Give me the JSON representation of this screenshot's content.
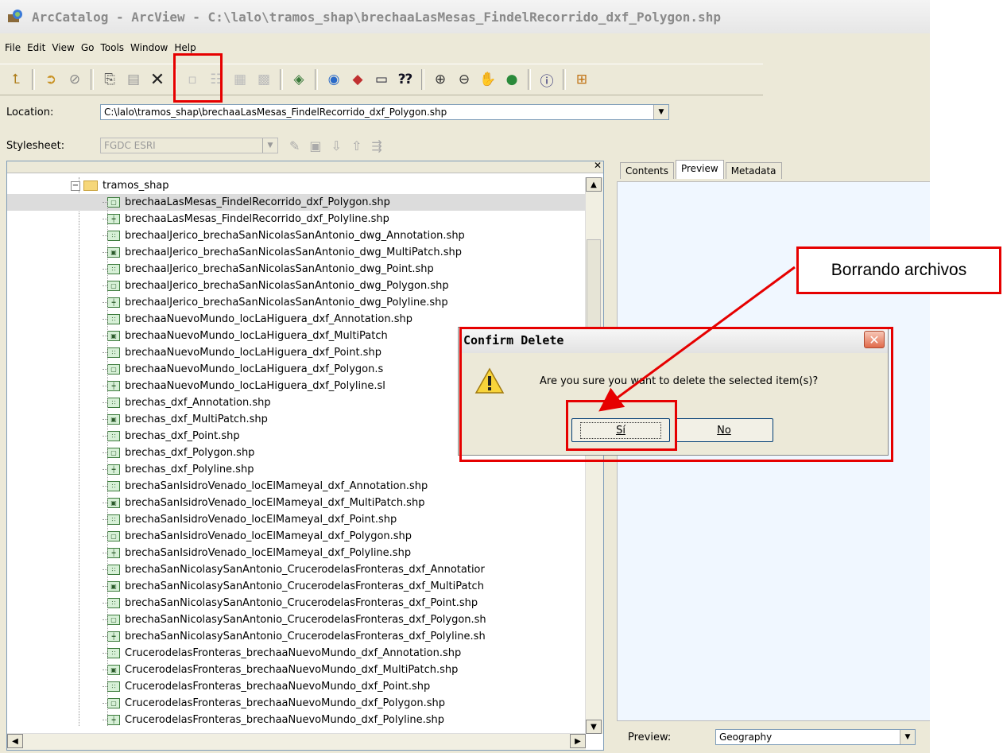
{
  "window": {
    "title": "ArcCatalog - ArcView - C:\\lalo\\tramos_shap\\brechaaLasMesas_FindelRecorrido_dxf_Polygon.shp"
  },
  "menu": [
    "File",
    "Edit",
    "View",
    "Go",
    "Tools",
    "Window",
    "Help"
  ],
  "location": {
    "label": "Location:",
    "value": "C:\\lalo\\tramos_shap\\brechaaLasMesas_FindelRecorrido_dxf_Polygon.shp"
  },
  "stylesheet": {
    "label": "Stylesheet:",
    "value": "FGDC ESRI"
  },
  "tree": {
    "folder": "tramos_shap",
    "items": [
      {
        "name": "brechaaLasMesas_FindelRecorrido_dxf_Polygon.shp",
        "type": "polygon"
      },
      {
        "name": "brechaaLasMesas_FindelRecorrido_dxf_Polyline.shp",
        "type": "polyline"
      },
      {
        "name": "brechaalJerico_brechaSanNicolasSanAntonio_dwg_Annotation.shp",
        "type": "point"
      },
      {
        "name": "brechaalJerico_brechaSanNicolasSanAntonio_dwg_MultiPatch.shp",
        "type": "multipatch"
      },
      {
        "name": "brechaalJerico_brechaSanNicolasSanAntonio_dwg_Point.shp",
        "type": "point"
      },
      {
        "name": "brechaalJerico_brechaSanNicolasSanAntonio_dwg_Polygon.shp",
        "type": "polygon"
      },
      {
        "name": "brechaalJerico_brechaSanNicolasSanAntonio_dwg_Polyline.shp",
        "type": "polyline"
      },
      {
        "name": "brechaaNuevoMundo_locLaHiguera_dxf_Annotation.shp",
        "type": "point"
      },
      {
        "name": "brechaaNuevoMundo_locLaHiguera_dxf_MultiPatch",
        "type": "multipatch"
      },
      {
        "name": "brechaaNuevoMundo_locLaHiguera_dxf_Point.shp",
        "type": "point"
      },
      {
        "name": "brechaaNuevoMundo_locLaHiguera_dxf_Polygon.s",
        "type": "polygon"
      },
      {
        "name": "brechaaNuevoMundo_locLaHiguera_dxf_Polyline.sl",
        "type": "polyline"
      },
      {
        "name": "brechas_dxf_Annotation.shp",
        "type": "point"
      },
      {
        "name": "brechas_dxf_MultiPatch.shp",
        "type": "multipatch"
      },
      {
        "name": "brechas_dxf_Point.shp",
        "type": "point"
      },
      {
        "name": "brechas_dxf_Polygon.shp",
        "type": "polygon"
      },
      {
        "name": "brechas_dxf_Polyline.shp",
        "type": "polyline"
      },
      {
        "name": "brechaSanIsidroVenado_locElMameyal_dxf_Annotation.shp",
        "type": "point"
      },
      {
        "name": "brechaSanIsidroVenado_locElMameyal_dxf_MultiPatch.shp",
        "type": "multipatch"
      },
      {
        "name": "brechaSanIsidroVenado_locElMameyal_dxf_Point.shp",
        "type": "point"
      },
      {
        "name": "brechaSanIsidroVenado_locElMameyal_dxf_Polygon.shp",
        "type": "polygon"
      },
      {
        "name": "brechaSanIsidroVenado_locElMameyal_dxf_Polyline.shp",
        "type": "polyline"
      },
      {
        "name": "brechaSanNicolasySanAntonio_CrucerodelasFronteras_dxf_Annotatior",
        "type": "point"
      },
      {
        "name": "brechaSanNicolasySanAntonio_CrucerodelasFronteras_dxf_MultiPatch",
        "type": "multipatch"
      },
      {
        "name": "brechaSanNicolasySanAntonio_CrucerodelasFronteras_dxf_Point.shp",
        "type": "point"
      },
      {
        "name": "brechaSanNicolasySanAntonio_CrucerodelasFronteras_dxf_Polygon.sh",
        "type": "polygon"
      },
      {
        "name": "brechaSanNicolasySanAntonio_CrucerodelasFronteras_dxf_Polyline.sh",
        "type": "polyline"
      },
      {
        "name": "CrucerodelasFronteras_brechaaNuevoMundo_dxf_Annotation.shp",
        "type": "point"
      },
      {
        "name": "CrucerodelasFronteras_brechaaNuevoMundo_dxf_MultiPatch.shp",
        "type": "multipatch"
      },
      {
        "name": "CrucerodelasFronteras_brechaaNuevoMundo_dxf_Point.shp",
        "type": "point"
      },
      {
        "name": "CrucerodelasFronteras_brechaaNuevoMundo_dxf_Polygon.shp",
        "type": "polygon"
      },
      {
        "name": "CrucerodelasFronteras_brechaaNuevoMundo_dxf_Polyline.shp",
        "type": "polyline"
      }
    ]
  },
  "tabs": [
    "Contents",
    "Preview",
    "Metadata"
  ],
  "active_tab": "Preview",
  "preview": {
    "label": "Preview:",
    "value": "Geography"
  },
  "dialog": {
    "title": "Confirm Delete",
    "message": "Are you sure you want to delete the selected item(s)?",
    "yes": "Sí",
    "no": "No"
  },
  "annotation": "Borrando archivos",
  "colors": {
    "highlight": "#e60000",
    "selection": "#dcdcdc"
  }
}
